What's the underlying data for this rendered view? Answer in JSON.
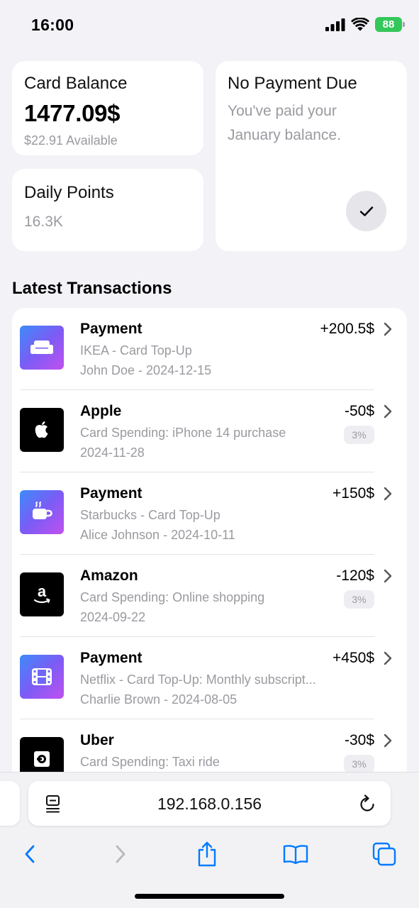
{
  "status_bar": {
    "time": "16:00",
    "battery": "88"
  },
  "balance_card": {
    "title": "Card Balance",
    "amount": "1477.09$",
    "available": "$22.91 Available"
  },
  "points_card": {
    "title": "Daily Points",
    "value": "16.3K"
  },
  "payment_card": {
    "title": "No Payment Due",
    "description": "You've paid your January balance."
  },
  "transactions": {
    "heading": "Latest Transactions",
    "items": [
      {
        "icon": "sofa-icon",
        "style": "grad",
        "title": "Payment",
        "sub1": "IKEA - Card Top-Up",
        "sub2": "John Doe - 2024-12-15",
        "amount": "+200.5$",
        "badge": ""
      },
      {
        "icon": "apple-logo-icon",
        "style": "dark",
        "title": "Apple",
        "sub1": "Card Spending: iPhone 14 purchase",
        "sub2": "2024-11-28",
        "amount": "-50$",
        "badge": "3%"
      },
      {
        "icon": "coffee-cup-icon",
        "style": "grad",
        "title": "Payment",
        "sub1": "Starbucks - Card Top-Up",
        "sub2": "Alice Johnson - 2024-10-11",
        "amount": "+150$",
        "badge": ""
      },
      {
        "icon": "amazon-logo-icon",
        "style": "dark",
        "title": "Amazon",
        "sub1": "Card Spending: Online shopping",
        "sub2": "2024-09-22",
        "amount": "-120$",
        "badge": "3%"
      },
      {
        "icon": "film-icon",
        "style": "grad",
        "title": "Payment",
        "sub1": "Netflix - Card Top-Up: Monthly subscript...",
        "sub2": "Charlie Brown - 2024-08-05",
        "amount": "+450$",
        "badge": ""
      },
      {
        "icon": "uber-logo-icon",
        "style": "dark",
        "title": "Uber",
        "sub1": "Card Spending: Taxi ride",
        "sub2": "",
        "amount": "-30$",
        "badge": "3%"
      }
    ]
  },
  "browser": {
    "url": "192.168.0.156"
  },
  "colors": {
    "accent": "#007aff",
    "battery": "#34c759",
    "muted_text": "#9a9aa0"
  }
}
